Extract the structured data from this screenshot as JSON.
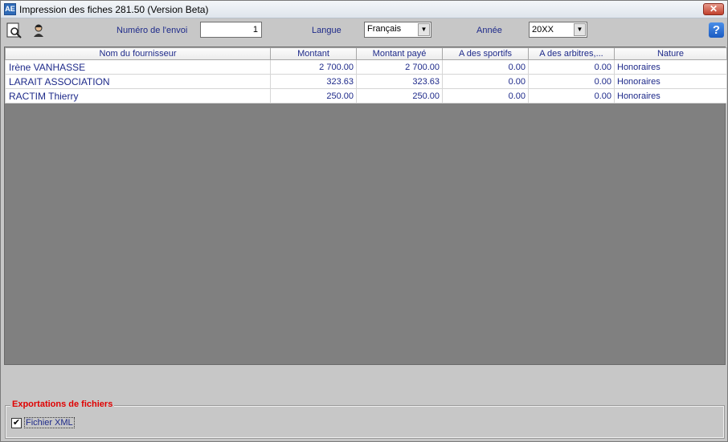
{
  "window": {
    "title": "Impression des fiches 281.50 (Version Beta)",
    "app_icon_text": "AE"
  },
  "toolbar": {
    "envoi_label": "Numéro de l'envoi",
    "envoi_value": "1",
    "langue_label": "Langue",
    "langue_value": "Français",
    "annee_label": "Année",
    "annee_value": "20XX",
    "help_glyph": "?"
  },
  "table": {
    "columns": [
      "Nom du fournisseur",
      "Montant",
      "Montant payé",
      "A des sportifs",
      "A des arbitres,...",
      "Nature"
    ],
    "rows": [
      [
        "Irène VANHASSE",
        "2 700.00",
        "2 700.00",
        "0.00",
        "0.00",
        "Honoraires"
      ],
      [
        "LARAIT ASSOCIATION",
        "323.63",
        "323.63",
        "0.00",
        "0.00",
        "Honoraires"
      ],
      [
        "RACTIM Thierry",
        "250.00",
        "250.00",
        "0.00",
        "0.00",
        "Honoraires"
      ]
    ]
  },
  "export": {
    "group_label": "Exportations de fichiers",
    "xml_label": "Fichier XML",
    "xml_checked": true
  },
  "colors": {
    "accent_text": "#1e2a8a",
    "legend_red": "#e00000",
    "grid_bg": "#808080"
  }
}
